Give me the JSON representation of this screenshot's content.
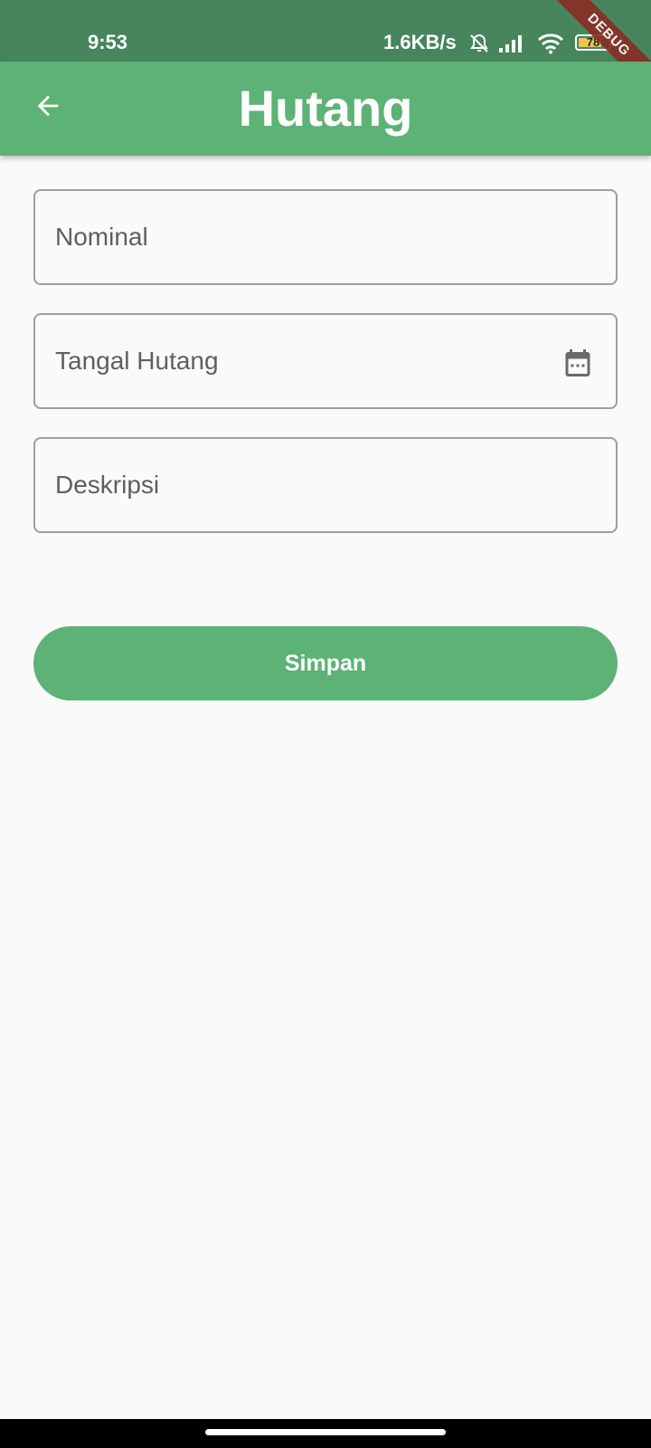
{
  "status_bar": {
    "time": "9:53",
    "network_speed": "1.6KB/s",
    "battery_level": "78",
    "battery_fraction": 0.78,
    "icons": [
      "muted-alarm-icon",
      "signal-icon",
      "wifi-icon",
      "battery-icon"
    ],
    "debug_banner": "DEBUG"
  },
  "app_bar": {
    "title": "Hutang",
    "back_icon": "arrow-left-icon"
  },
  "form": {
    "nominal_placeholder": "Nominal",
    "date_placeholder": "Tangal Hutang",
    "date_icon": "calendar-icon",
    "description_placeholder": "Deskripsi",
    "save_label": "Simpan"
  },
  "colors": {
    "status_bar": "#47855c",
    "primary": "#5db275",
    "background": "#fafafa",
    "field_border": "#9e9e9e",
    "debug_ribbon": "#8b2d24"
  }
}
